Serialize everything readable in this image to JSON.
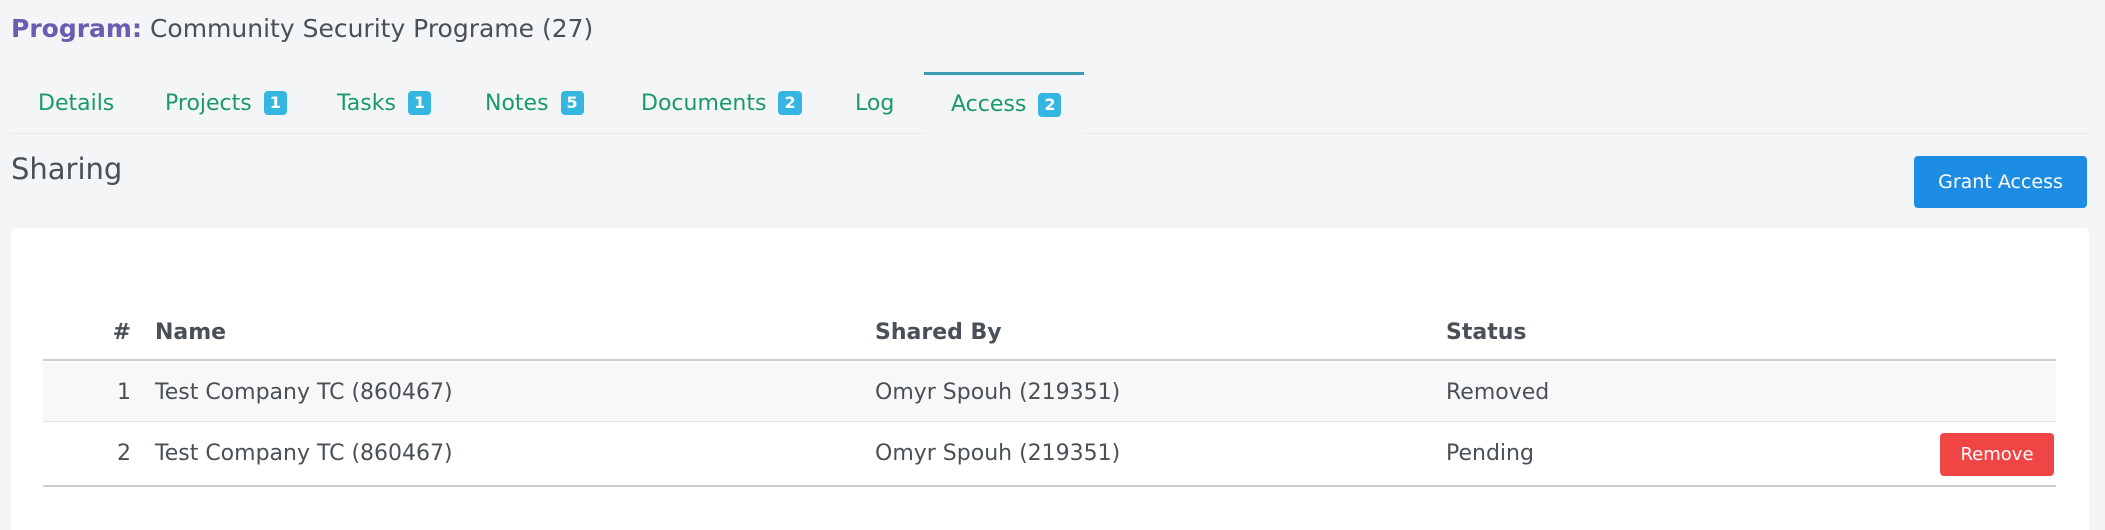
{
  "header": {
    "label": "Program:",
    "value": "Community Security Programe (27)"
  },
  "tabs": [
    {
      "label": "Details",
      "badge": null
    },
    {
      "label": "Projects",
      "badge": "1"
    },
    {
      "label": "Tasks",
      "badge": "1"
    },
    {
      "label": "Notes",
      "badge": "5"
    },
    {
      "label": "Documents",
      "badge": "2"
    },
    {
      "label": "Log",
      "badge": null
    },
    {
      "label": "Access",
      "badge": "2",
      "active": true
    }
  ],
  "section": {
    "title": "Sharing",
    "grant_button": "Grant Access"
  },
  "table": {
    "columns": [
      "#",
      "Name",
      "Shared By",
      "Status"
    ],
    "rows": [
      {
        "num": "1",
        "name": "Test Company TC (860467)",
        "shared_by": "Omyr Spouh (219351)",
        "status": "Removed",
        "action": null
      },
      {
        "num": "2",
        "name": "Test Company TC (860467)",
        "shared_by": "Omyr Spouh (219351)",
        "status": "Pending",
        "action": "Remove"
      }
    ]
  },
  "colors": {
    "tab_text": "#1a9a6c",
    "badge": "#35b6e0",
    "primary": "#1d8ce3",
    "danger": "#f04545",
    "header_label": "#6a5cb0"
  }
}
